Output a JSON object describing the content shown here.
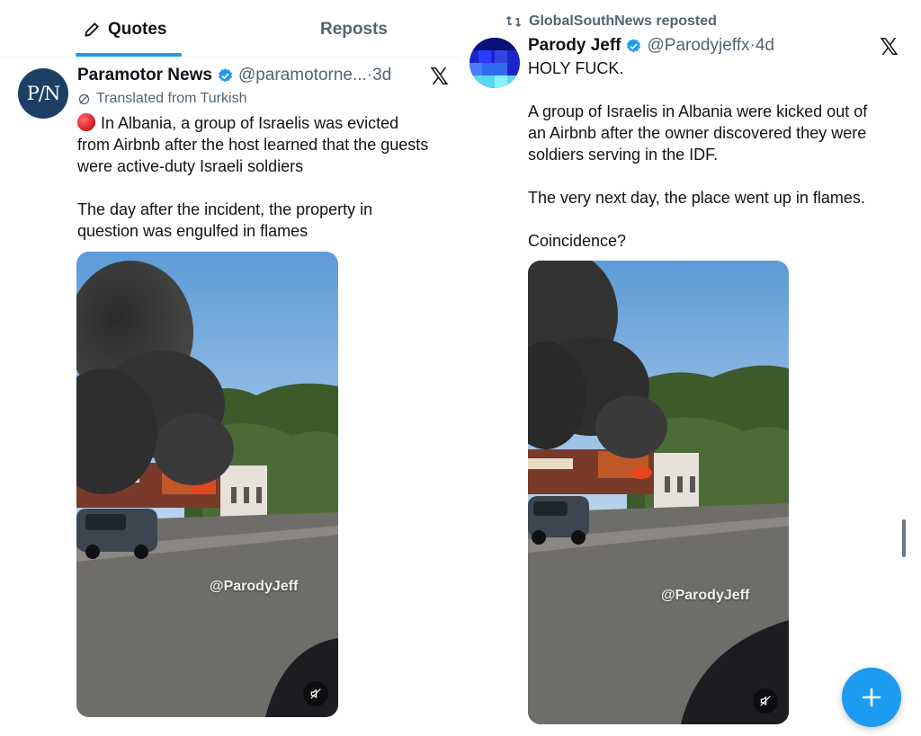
{
  "tabs": {
    "quotes_label": "Quotes",
    "reposts_label": "Reposts"
  },
  "left_post": {
    "avatar_text": "P/N",
    "author_name": "Paramotor News",
    "author_handle": "@paramotorne...",
    "separator": "·",
    "time": "3d",
    "translated_label": "Translated from Turkish",
    "text_line1": "In Albania, a group of Israelis was evicted",
    "text_line2": "from Airbnb after the host learned that the guests",
    "text_line3": "were active-duty Israeli soldiers",
    "text_line4": "The day after the incident, the property in",
    "text_line5": "question was engulfed in flames",
    "video_watermark": "@ParodyJeff",
    "status_icon": "red-circle-emoji",
    "verified_color": "#1d9bf0"
  },
  "right_post": {
    "repost_label": "GlobalSouthNews reposted",
    "author_name": "Parody Jeff",
    "author_handle": "@Parodyjeffx",
    "separator": "·",
    "time": "4d",
    "text_line1": "HOLY FUCK.",
    "text_line2": "A group of Israelis in Albania were kicked out of",
    "text_line3": "an Airbnb after the owner discovered they were",
    "text_line4": "soldiers serving in the IDF.",
    "text_line5": "The very next day, the place went up in flames.",
    "text_line6": "Coincidence?",
    "video_watermark": "@ParodyJeff"
  },
  "fab": {
    "label": "+",
    "color": "#1d9bf0"
  }
}
